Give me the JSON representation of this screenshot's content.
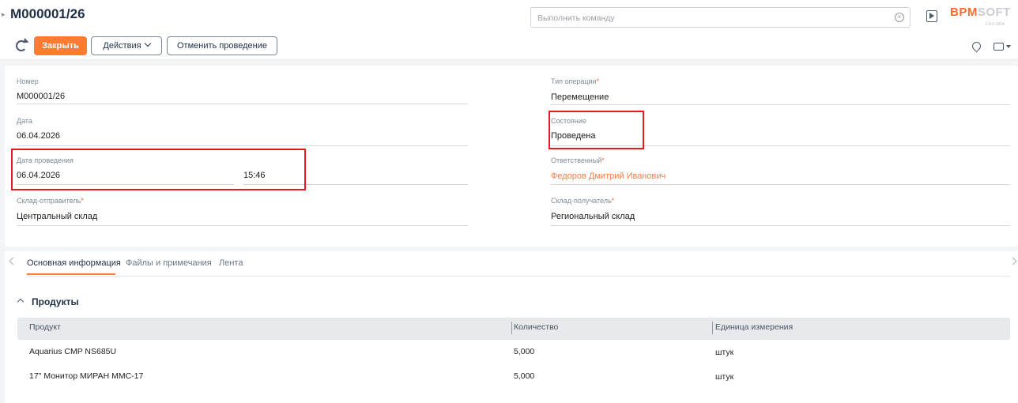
{
  "header": {
    "title": "М000001/26",
    "command_placeholder": "Выполнить команду",
    "logo_part1": "BPM",
    "logo_part2": "SOFT",
    "logo_version": "1.9.0.1914"
  },
  "toolbar": {
    "close_label": "Закрыть",
    "actions_label": "Действия",
    "cancel_label": "Отменить проведение"
  },
  "form": {
    "number_label": "Номер",
    "number_value": "М000001/26",
    "date_label": "Дата",
    "date_value": "06.04.2026",
    "posting_date_label": "Дата проведения",
    "posting_date_value": "06.04.2026",
    "posting_time_value": "15:46",
    "sender_label": "Склад-отправитель",
    "sender_value": "Центральный склад",
    "operation_type_label": "Тип операции",
    "operation_type_value": "Перемещение",
    "state_label": "Состояние",
    "state_value": "Проведена",
    "responsible_label": "Ответственный",
    "responsible_value": "Федоров Дмитрий Иванович",
    "receiver_label": "Склад-получатель",
    "receiver_value": "Региональный склад",
    "required_mark": "*"
  },
  "tabs": [
    {
      "label": "Основная информация"
    },
    {
      "label": "Файлы и примечания"
    },
    {
      "label": "Лента"
    }
  ],
  "products": {
    "title": "Продукты",
    "columns": [
      "Продукт",
      "Количество",
      "Единица измерения"
    ],
    "rows": [
      {
        "product": "Aquarius CMP NS685U",
        "qty": "5,000",
        "unit": "штук"
      },
      {
        "product": "17\" Монитор МИРАН ММС-17",
        "qty": "5,000",
        "unit": "штук"
      }
    ]
  },
  "colors": {
    "accent": "#ff7a33",
    "highlight": "#e81919",
    "link": "#ef7f4a"
  }
}
